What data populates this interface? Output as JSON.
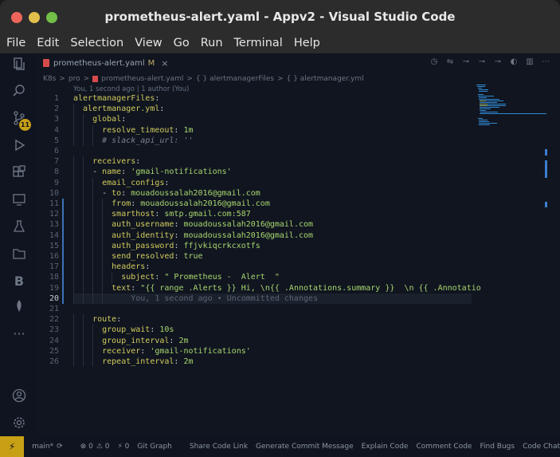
{
  "window": {
    "title": "prometheus-alert.yaml - Appv2 - Visual Studio Code"
  },
  "menu": [
    "File",
    "Edit",
    "Selection",
    "View",
    "Go",
    "Run",
    "Terminal",
    "Help"
  ],
  "activity": {
    "icons": [
      "explorer-icon",
      "search-icon",
      "source-control-icon",
      "run-debug-icon",
      "extensions-icon",
      "remote-explorer-icon",
      "testing-icon",
      "folder-icon",
      "b-icon",
      "mongodb-icon",
      "more-icon",
      "account-icon",
      "settings-icon"
    ],
    "scm_badge": "11",
    "b_label": "B",
    "more_label": "···"
  },
  "tab": {
    "label": "prometheus-alert.yaml",
    "modified": "M",
    "close": "×"
  },
  "breadcrumb": {
    "k8s": "K8s",
    "sep": ">",
    "pro": "pro",
    "file": "prometheus-alert.yaml",
    "alertmanagerFiles": "{ } alertmanagerFiles",
    "alertmanager_yml": "{ } alertmanager.yml"
  },
  "blame_top": "You, 1 second ago | 1 author (You)",
  "code": [
    {
      "n": "1",
      "indent": 0,
      "tokens": [
        [
          "k",
          "alertmanagerFiles"
        ],
        [
          "p",
          ":"
        ]
      ]
    },
    {
      "n": "2",
      "indent": 1,
      "tokens": [
        [
          "k",
          "alertmanager.yml"
        ],
        [
          "p",
          ":"
        ]
      ]
    },
    {
      "n": "3",
      "indent": 2,
      "tokens": [
        [
          "k",
          "global"
        ],
        [
          "p",
          ":"
        ]
      ]
    },
    {
      "n": "4",
      "indent": 3,
      "tokens": [
        [
          "k",
          "resolve_timeout"
        ],
        [
          "p",
          ": "
        ],
        [
          "s",
          "1m"
        ]
      ]
    },
    {
      "n": "5",
      "indent": 3,
      "tokens": [
        [
          "cm",
          "# slack_api_url: ''"
        ]
      ]
    },
    {
      "n": "6",
      "indent": 0,
      "tokens": []
    },
    {
      "n": "7",
      "indent": 2,
      "tokens": [
        [
          "k",
          "receivers"
        ],
        [
          "p",
          ":"
        ]
      ]
    },
    {
      "n": "8",
      "indent": 2,
      "tokens": [
        [
          "p",
          "- "
        ],
        [
          "k",
          "name"
        ],
        [
          "p",
          ": "
        ],
        [
          "s",
          "'gmail-notifications'"
        ]
      ]
    },
    {
      "n": "9",
      "indent": 3,
      "tokens": [
        [
          "k",
          "email_configs"
        ],
        [
          "p",
          ":"
        ]
      ]
    },
    {
      "n": "10",
      "indent": 3,
      "tokens": [
        [
          "p",
          "- "
        ],
        [
          "k",
          "to"
        ],
        [
          "p",
          ": "
        ],
        [
          "s",
          "mouadoussalah2016@gmail.com"
        ]
      ]
    },
    {
      "n": "11",
      "indent": 4,
      "tokens": [
        [
          "k",
          "from"
        ],
        [
          "p",
          ": "
        ],
        [
          "s",
          "mouadoussalah2016@gmail.com"
        ]
      ]
    },
    {
      "n": "12",
      "indent": 4,
      "tokens": [
        [
          "k",
          "smarthost"
        ],
        [
          "p",
          ": "
        ],
        [
          "s",
          "smtp.gmail.com:587"
        ]
      ]
    },
    {
      "n": "13",
      "indent": 4,
      "tokens": [
        [
          "k",
          "auth_username"
        ],
        [
          "p",
          ": "
        ],
        [
          "s",
          "mouadoussalah2016@gmail.com"
        ]
      ]
    },
    {
      "n": "14",
      "indent": 4,
      "tokens": [
        [
          "k",
          "auth_identity"
        ],
        [
          "p",
          ": "
        ],
        [
          "s",
          "mouadoussalah2016@gmail.com"
        ]
      ]
    },
    {
      "n": "15",
      "indent": 4,
      "tokens": [
        [
          "k",
          "auth_password"
        ],
        [
          "p",
          ": "
        ],
        [
          "s",
          "ffjvkiqcrkcxotfs"
        ]
      ]
    },
    {
      "n": "16",
      "indent": 4,
      "tokens": [
        [
          "k",
          "send_resolved"
        ],
        [
          "p",
          ": "
        ],
        [
          "s",
          "true"
        ]
      ]
    },
    {
      "n": "17",
      "indent": 4,
      "tokens": [
        [
          "k",
          "headers"
        ],
        [
          "p",
          ":"
        ]
      ]
    },
    {
      "n": "18",
      "indent": 5,
      "tokens": [
        [
          "k",
          "subject"
        ],
        [
          "p",
          ": "
        ],
        [
          "s",
          "\" Prometheus -  Alert  \""
        ]
      ]
    },
    {
      "n": "19",
      "indent": 4,
      "tokens": [
        [
          "k",
          "text"
        ],
        [
          "p",
          ": "
        ],
        [
          "s",
          "\"{{ range .Alerts }} Hi, \\n{{ .Annotations.summary }}  \\n {{ .Annotatio"
        ]
      ]
    },
    {
      "n": "20",
      "indent": 4,
      "tokens": [
        [
          "ghost",
          "    You, 1 second ago • Uncommitted changes"
        ]
      ],
      "active": true
    },
    {
      "n": "21",
      "indent": 0,
      "tokens": []
    },
    {
      "n": "22",
      "indent": 2,
      "tokens": [
        [
          "k",
          "route"
        ],
        [
          "p",
          ":"
        ]
      ]
    },
    {
      "n": "23",
      "indent": 3,
      "tokens": [
        [
          "k",
          "group_wait"
        ],
        [
          "p",
          ": "
        ],
        [
          "s",
          "10s"
        ]
      ]
    },
    {
      "n": "24",
      "indent": 3,
      "tokens": [
        [
          "k",
          "group_interval"
        ],
        [
          "p",
          ": "
        ],
        [
          "s",
          "2m"
        ]
      ]
    },
    {
      "n": "25",
      "indent": 3,
      "tokens": [
        [
          "k",
          "receiver"
        ],
        [
          "p",
          ": "
        ],
        [
          "s",
          "'gmail-notifications'"
        ]
      ]
    },
    {
      "n": "26",
      "indent": 3,
      "tokens": [
        [
          "k",
          "repeat_interval"
        ],
        [
          "p",
          ": "
        ],
        [
          "s",
          "2m"
        ]
      ]
    }
  ],
  "modified_lines": [
    "11",
    "12",
    "13",
    "14",
    "15",
    "16",
    "17",
    "18",
    "19",
    "20"
  ],
  "status": {
    "remote": "⚡",
    "branch": "main*",
    "sync": "⟳",
    "errors": "⊗ 0",
    "warnings": "⚠ 0",
    "ports": "⚡ 0",
    "items": [
      "Git Graph",
      "Share Code Link",
      "Generate Commit Message",
      "Explain Code",
      "Comment Code",
      "Find Bugs",
      "Code Chat"
    ]
  },
  "colors": {
    "key": "#d1cb5d",
    "string": "#a8d66e",
    "comment": "#7a8290",
    "accent": "#c7a015",
    "background": "#101520"
  }
}
